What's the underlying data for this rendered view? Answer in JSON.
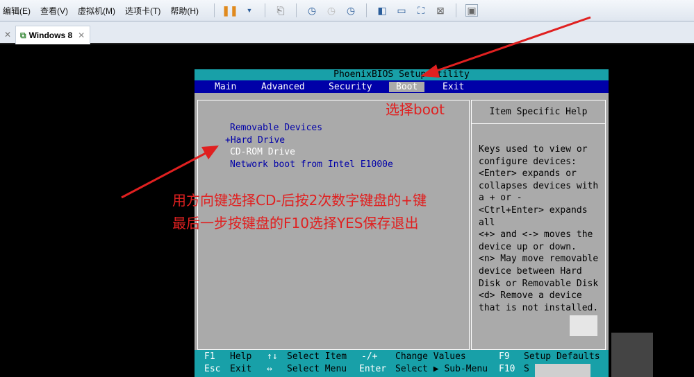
{
  "toolbar": {
    "menus": [
      "编辑(E)",
      "查看(V)",
      "虚拟机(M)",
      "选项卡(T)",
      "帮助(H)"
    ]
  },
  "tabs": {
    "active": "Windows 8"
  },
  "bios": {
    "title": "PhoenixBIOS Setup Utility",
    "menu": [
      "Main",
      "Advanced",
      "Security",
      "Boot",
      "Exit"
    ],
    "selected_menu": "Boot",
    "boot_items": [
      "Removable Devices",
      "+Hard Drive",
      "CD-ROM Drive",
      "Network boot from Intel E1000e"
    ],
    "selected_item": "CD-ROM Drive",
    "help_title": "Item Specific Help",
    "help_lines": [
      "Keys used to view or",
      "configure devices:",
      "<Enter> expands or",
      "collapses devices with",
      "a + or -",
      "<Ctrl+Enter> expands",
      "all",
      "<+> and <-> moves the",
      "device up or down.",
      "<n> May move removable",
      "device between Hard",
      "Disk or Removable Disk",
      "<d> Remove a device",
      "that is not installed."
    ],
    "footer": {
      "f1": "F1",
      "help": "Help",
      "updown": "↑↓",
      "select_item": "Select Item",
      "minusplus": "-/+",
      "change_values": "Change Values",
      "f9": "F9",
      "setup_defaults": "Setup Defaults",
      "esc": "Esc",
      "exit": "Exit",
      "leftright": "↔",
      "select_menu": "Select Menu",
      "enter": "Enter",
      "select_submenu": "Select ▶ Sub-Menu",
      "f10": "F10",
      "save_exit": "S"
    }
  },
  "annotations": {
    "boot": "选择boot",
    "line1": "用方向键选择CD-后按2次数字键盘的+键",
    "line2": "最后一步按键盘的F10选择YES保存退出",
    "color": "#e02020"
  }
}
